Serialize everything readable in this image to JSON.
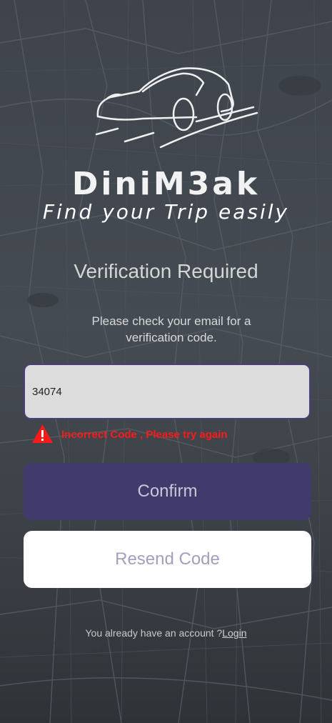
{
  "brand": {
    "name": "DiniM3ak",
    "tagline": "Find your Trip easily"
  },
  "logo": {
    "icon": "car-logo-icon"
  },
  "verification": {
    "title": "Verification Required",
    "subtitle": "Please check your email for a verification code.",
    "code_value": "34074",
    "error_icon": "warning-icon",
    "error_message": "Incorrect Code , Please try again"
  },
  "buttons": {
    "confirm": "Confirm",
    "resend": "Resend Code"
  },
  "footer": {
    "text": "You already have an account ?",
    "login_link": "Login"
  },
  "colors": {
    "background": "#42474e",
    "primary_button": "#403b6c",
    "error": "#ff1a1a",
    "input_bg": "#dcdcdc"
  }
}
